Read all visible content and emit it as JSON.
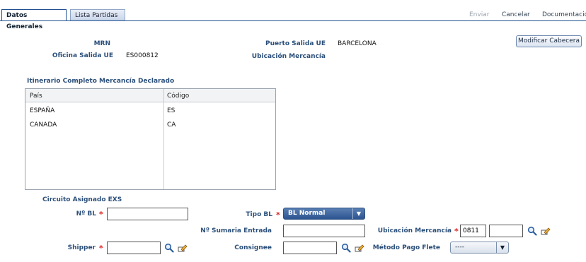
{
  "tabs": [
    {
      "label": "Datos Generales"
    },
    {
      "label": "Lista Partidas"
    }
  ],
  "toolbar": {
    "enviar": "Enviar",
    "cancelar": "Cancelar",
    "documentacion": "Documentación"
  },
  "header": {
    "mrn_label": "MRN",
    "mrn_value": "",
    "oficina_label": "Oficina Salida UE",
    "oficina_value": "ES000812",
    "puerto_label": "Puerto Salida UE",
    "puerto_value": "BARCELONA",
    "ubicacion_label": "Ubicación Mercancía",
    "ubicacion_value": "",
    "modificar_button": "Modificar Cabecera"
  },
  "itinerario": {
    "title": "Itinerario Completo Mercancía Declarado",
    "columns": [
      "País",
      "Código"
    ],
    "rows": [
      [
        "ESPAÑA",
        "ES"
      ],
      [
        "CANADA",
        "CA"
      ]
    ]
  },
  "circuito": {
    "title": "Circuito Asignado EXS"
  },
  "form": {
    "nbl_label": "Nº BL",
    "nbl_value": "",
    "tipo_bl_label": "Tipo BL",
    "tipo_bl_value": "BL Normal",
    "sumaria_label": "Nº Sumaria Entrada",
    "sumaria_value": "",
    "ubicacion_label": "Ubicación Mercancía",
    "ubicacion_value_1": "0811",
    "ubicacion_value_2": "",
    "shipper_label": "Shipper",
    "shipper_value": "",
    "consignee_label": "Consignee",
    "consignee_value": "",
    "metodo_label": "Método Pago Flete",
    "metodo_value": "----",
    "required_mark": "*"
  },
  "icons": {
    "search": "search-icon",
    "edit": "edit-icon"
  }
}
